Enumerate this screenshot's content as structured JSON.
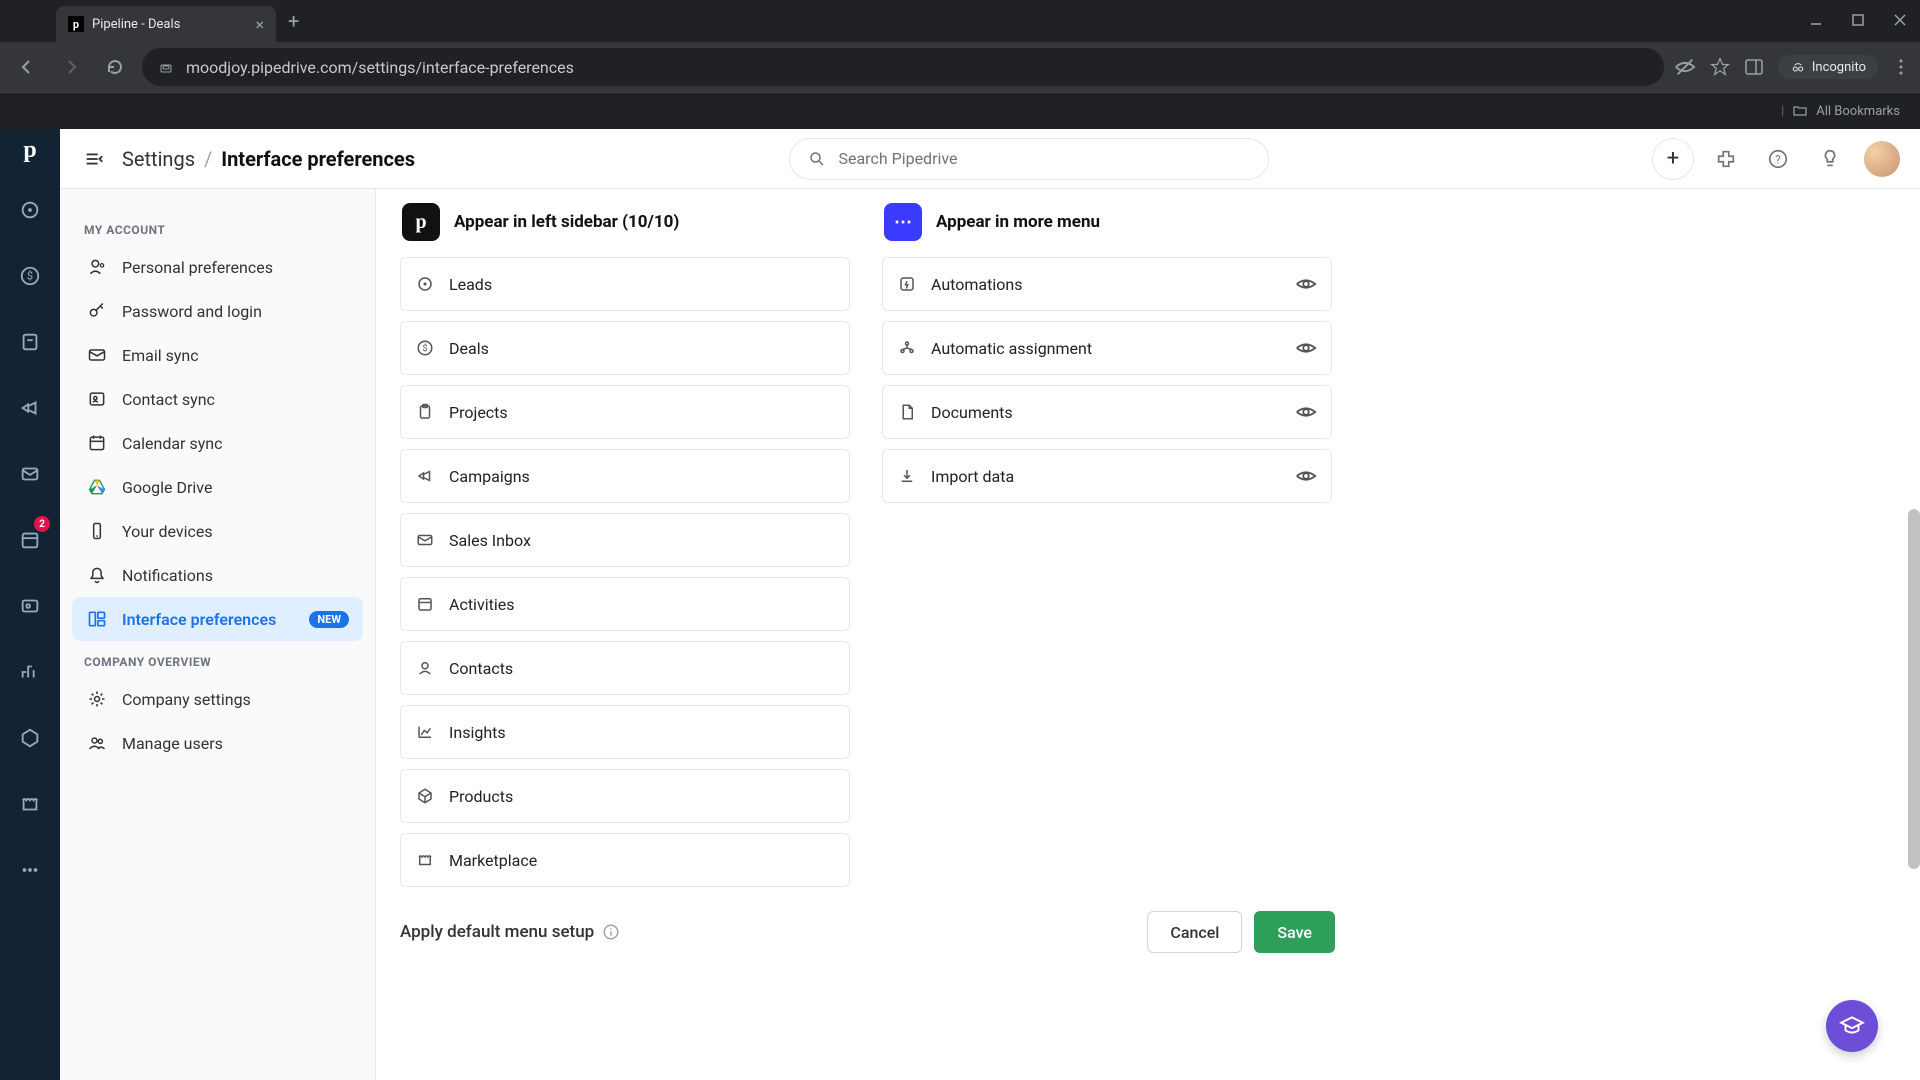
{
  "browser": {
    "tab_title": "Pipeline - Deals",
    "url": "moodjoy.pipedrive.com/settings/interface-preferences",
    "incognito": "Incognito",
    "all_bookmarks": "All Bookmarks"
  },
  "header": {
    "breadcrumb_root": "Settings",
    "breadcrumb_current": "Interface preferences",
    "search_placeholder": "Search Pipedrive"
  },
  "sidebar": {
    "section_my_account": "MY ACCOUNT",
    "items_a": [
      {
        "label": "Personal preferences"
      },
      {
        "label": "Password and login"
      },
      {
        "label": "Email sync"
      },
      {
        "label": "Contact sync"
      },
      {
        "label": "Calendar sync"
      },
      {
        "label": "Google Drive"
      },
      {
        "label": "Your devices"
      },
      {
        "label": "Notifications"
      },
      {
        "label": "Interface preferences",
        "badge": "NEW"
      }
    ],
    "section_company": "COMPANY OVERVIEW",
    "items_b": [
      {
        "label": "Company settings"
      },
      {
        "label": "Manage users"
      }
    ]
  },
  "content": {
    "col_left_title": "Appear in left sidebar (10/10)",
    "col_right_title": "Appear in more menu",
    "left_items": [
      "Leads",
      "Deals",
      "Projects",
      "Campaigns",
      "Sales Inbox",
      "Activities",
      "Contacts",
      "Insights",
      "Products",
      "Marketplace"
    ],
    "right_items": [
      "Automations",
      "Automatic assignment",
      "Documents",
      "Import data"
    ],
    "apply_default": "Apply default menu setup",
    "cancel": "Cancel",
    "save": "Save"
  },
  "rail_badge": "2"
}
